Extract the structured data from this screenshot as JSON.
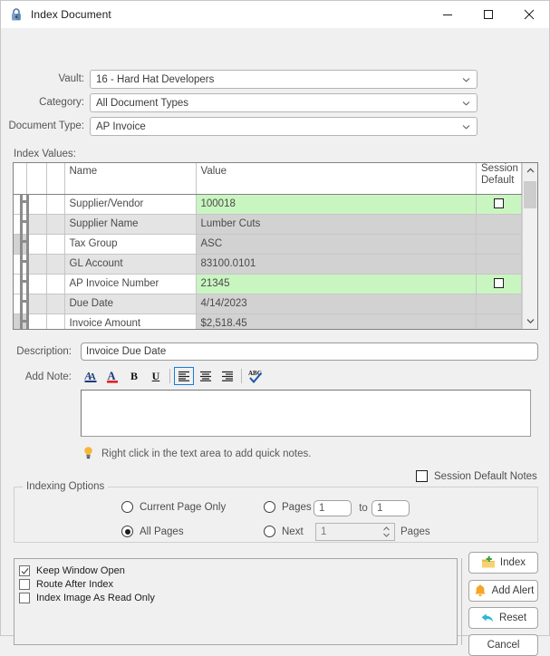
{
  "window": {
    "title": "Index Document",
    "lock_icon": "lock-icon",
    "controls": {
      "minimize": "minimize-icon",
      "maximize": "maximize-icon",
      "close": "close-icon"
    }
  },
  "form": {
    "vault_label": "Vault:",
    "vault_value": "16 - Hard Hat Developers",
    "category_label": "Category:",
    "category_value": "All Document Types",
    "doctype_label": "Document Type:",
    "doctype_value": "AP Invoice"
  },
  "index_values": {
    "label": "Index Values:",
    "columns": [
      "",
      "",
      "",
      "Name",
      "Value",
      "Session\nDefault"
    ],
    "col_name": "Name",
    "col_value": "Value",
    "col_session_line1": "Session",
    "col_session_line2": "Default",
    "rows": [
      {
        "name": "Supplier/Vendor",
        "value": "100018",
        "style": "edit",
        "session_default_checkbox": true,
        "checked": false
      },
      {
        "name": "Supplier Name",
        "value": "Lumber Cuts",
        "style": "ro",
        "session_default_checkbox": false,
        "checked": false
      },
      {
        "name": "Tax Group",
        "value": "ASC",
        "style": "alt",
        "session_default_checkbox": false,
        "checked": false
      },
      {
        "name": "GL Account",
        "value": "83100.0101",
        "style": "ro",
        "session_default_checkbox": false,
        "checked": false
      },
      {
        "name": "AP Invoice Number",
        "value": "21345",
        "style": "edit",
        "session_default_checkbox": true,
        "checked": false
      },
      {
        "name": "Due Date",
        "value": "4/14/2023",
        "style": "ro",
        "session_default_checkbox": false,
        "checked": false
      },
      {
        "name": "Invoice Amount",
        "value": "$2,518.45",
        "style": "alt",
        "session_default_checkbox": false,
        "checked": false
      }
    ]
  },
  "description": {
    "label": "Description:",
    "value": "Invoice Due Date"
  },
  "note": {
    "label": "Add Note:",
    "value": "",
    "toolbar": [
      {
        "name": "font-color-icon",
        "title": "Font Color"
      },
      {
        "name": "text-highlight-icon",
        "title": "Text Highlight"
      },
      {
        "name": "bold-icon",
        "title": "Bold",
        "glyph": "B"
      },
      {
        "name": "underline-icon",
        "title": "Underline",
        "glyph": "U"
      },
      {
        "name": "align-left-icon",
        "title": "Align Left",
        "selected": true
      },
      {
        "name": "align-center-icon",
        "title": "Align Center"
      },
      {
        "name": "align-right-icon",
        "title": "Align Right"
      },
      {
        "name": "spell-check-icon",
        "title": "Spell Check"
      }
    ],
    "hint_icon": "lightbulb-icon",
    "hint_text": "Right click in the text area to add quick notes."
  },
  "session_default_notes": {
    "label": "Session Default Notes",
    "checked": false
  },
  "indexing_options": {
    "title": "Indexing Options",
    "current_page_only": {
      "label": "Current Page Only",
      "selected": false
    },
    "all_pages": {
      "label": "All Pages",
      "selected": true
    },
    "pages": {
      "label": "Pages",
      "selected": false,
      "from": "1",
      "to_label": "to",
      "to": "1"
    },
    "next": {
      "label": "Next",
      "selected": false,
      "count": "1",
      "suffix": "Pages"
    }
  },
  "bottom_options": [
    {
      "label": "Keep Window Open",
      "checked": true
    },
    {
      "label": "Route After Index",
      "checked": false
    },
    {
      "label": "Index Image As Read Only",
      "checked": false
    }
  ],
  "buttons": [
    {
      "label": "Index",
      "icon": "folder-add-icon"
    },
    {
      "label": "Add Alert",
      "icon": "bell-icon"
    },
    {
      "label": "Reset",
      "icon": "undo-arrow-icon"
    },
    {
      "label": "Cancel",
      "icon": ""
    }
  ],
  "colors": {
    "editable_row": "#c9f5c1",
    "readonly_row": "#d2d2d2",
    "accent_selected": "#1b7bd4",
    "bell": "#f5a623",
    "undo": "#29b6d8",
    "window_bg": "#f0f0f0"
  }
}
